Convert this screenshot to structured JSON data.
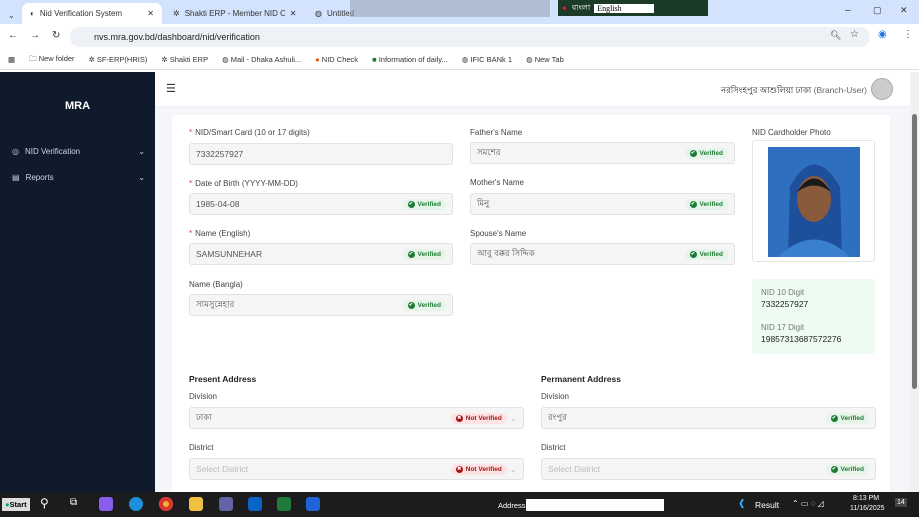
{
  "browser": {
    "tabs": [
      {
        "label": "Nid Verification System",
        "active": true
      },
      {
        "label": "Shakti ERP - Member NID Or S..."
      },
      {
        "label": "Untitled"
      }
    ],
    "overlay": {
      "bangla": "বাংলা",
      "lang": "English"
    },
    "url": "nvs.mra.gov.bd/dashboard/nid/verification",
    "bookmarks": [
      "New folder",
      "SF-ERP(HRIS)",
      "Shakti ERP",
      "Mail - Dhaka Ashuli...",
      "NID Check",
      "Information of daily...",
      "IFIC BANk 1",
      "New Tab"
    ]
  },
  "sidebar": {
    "logo": "MRA",
    "items": [
      {
        "label": "NID Verification"
      },
      {
        "label": "Reports"
      }
    ]
  },
  "header": {
    "user": "নরসিংহপুর আশুলিয়া ঢাকা",
    "role": "(Branch-User)"
  },
  "form": {
    "nid": {
      "label": "NID/Smart Card (10 or 17 digits)",
      "value": "7332257927"
    },
    "dob": {
      "label": "Date of Birth (YYYY-MM-DD)",
      "value": "1985-04-08",
      "status": "Verified"
    },
    "name_en": {
      "label": "Name (English)",
      "value": "SAMSUNNEHAR",
      "status": "Verified"
    },
    "name_bn": {
      "label": "Name (Bangla)",
      "value": "সামসুন্নেহার",
      "status": "Verified"
    },
    "father": {
      "label": "Father's Name",
      "value": "সমশের",
      "status": "Verified"
    },
    "mother": {
      "label": "Mother's Name",
      "value": "মিনু",
      "status": "Verified"
    },
    "spouse": {
      "label": "Spouse's Name",
      "value": "আবু বক্কর সিদ্দিক",
      "status": "Verified"
    },
    "photo_label": "NID Cardholder Photo",
    "nid10": {
      "label": "NID 10 Digit",
      "value": "7332257927"
    },
    "nid17": {
      "label": "NID 17 Digit",
      "value": "19857313687572276"
    },
    "present": {
      "title": "Present Address",
      "division_label": "Division",
      "division": "ঢাকা",
      "division_status": "Not Verified",
      "district_label": "District",
      "district_placeholder": "Select District",
      "district_status": "Not Verified"
    },
    "permanent": {
      "title": "Permanent Address",
      "division_label": "Division",
      "division": "রংপুর",
      "division_status": "Verified",
      "district_label": "District",
      "district_placeholder": "Select District",
      "district_status": "Verified"
    }
  },
  "taskbar": {
    "start": "Start",
    "address_label": "Address",
    "result": "Result",
    "time": "8:13 PM",
    "date": "11/16/2025",
    "notif": "14"
  }
}
